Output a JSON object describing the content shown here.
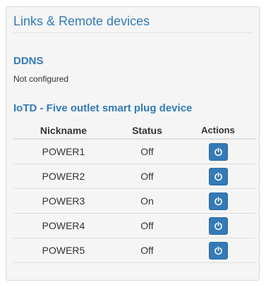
{
  "panel": {
    "title": "Links & Remote devices"
  },
  "ddns": {
    "heading": "DDNS",
    "status": "Not configured"
  },
  "iotd": {
    "heading": "IoTD - Five outlet smart plug device",
    "columns": {
      "nickname": "Nickname",
      "status": "Status",
      "actions": "Actions"
    },
    "rows": [
      {
        "nickname": "POWER1",
        "status": "Off",
        "action_icon": "power-icon"
      },
      {
        "nickname": "POWER2",
        "status": "Off",
        "action_icon": "power-icon"
      },
      {
        "nickname": "POWER3",
        "status": "On",
        "action_icon": "power-icon"
      },
      {
        "nickname": "POWER4",
        "status": "Off",
        "action_icon": "power-icon"
      },
      {
        "nickname": "POWER5",
        "status": "Off",
        "action_icon": "power-icon"
      }
    ]
  },
  "colors": {
    "accent": "#337ab7",
    "panel_background": "#f5f5f5"
  }
}
